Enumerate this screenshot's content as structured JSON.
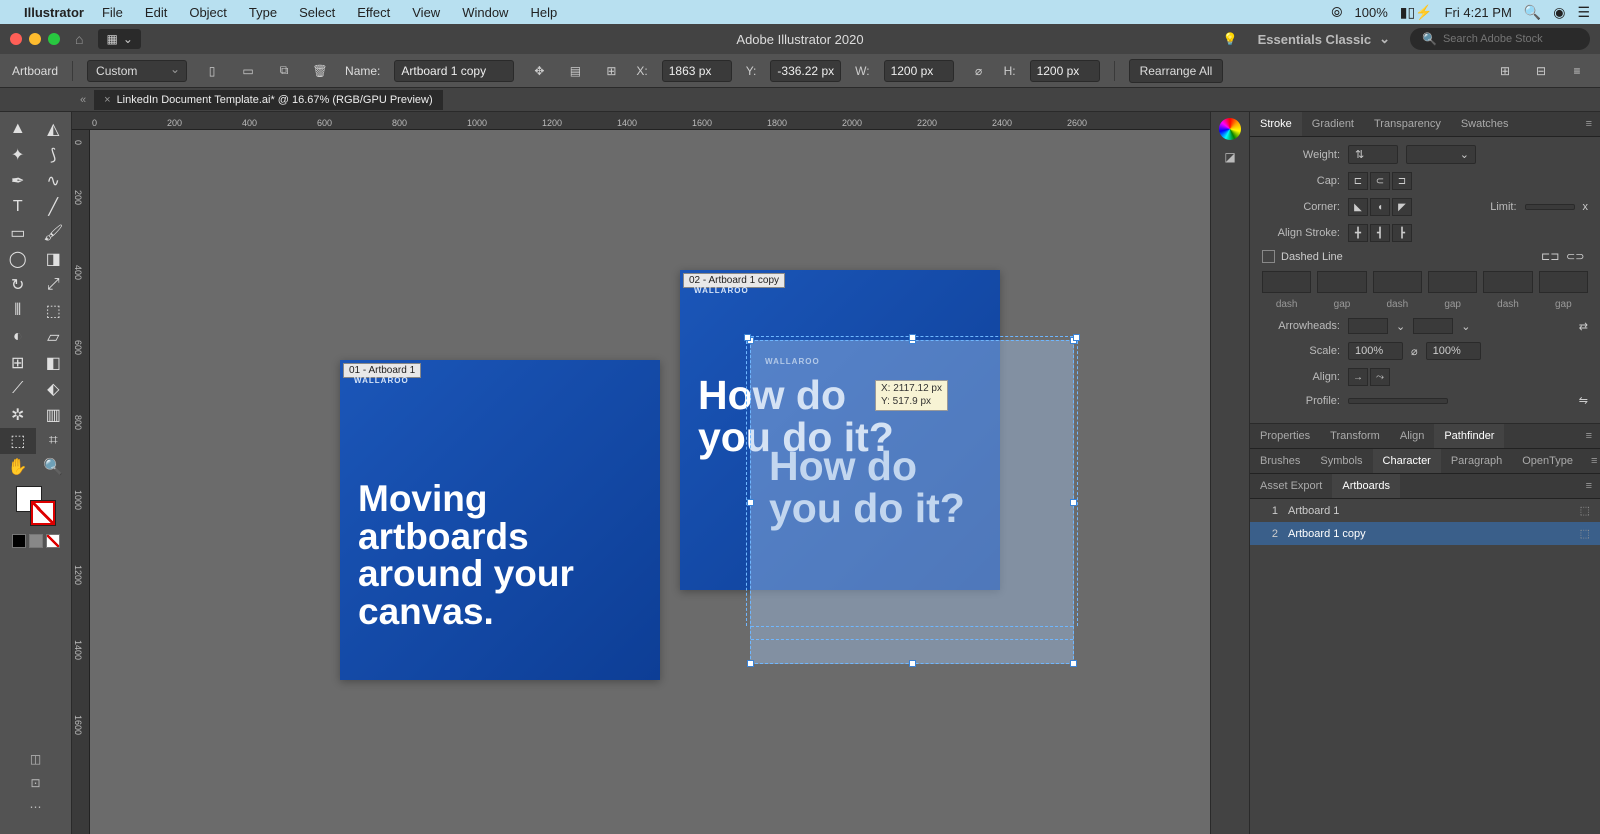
{
  "mac_menu": {
    "app": "Illustrator",
    "items": [
      "File",
      "Edit",
      "Object",
      "Type",
      "Select",
      "Effect",
      "View",
      "Window",
      "Help"
    ],
    "wifi": "wifi-icon",
    "battery_pct": "100%",
    "battery_icon": "battery-charging-icon",
    "clock": "Fri 4:21 PM"
  },
  "titlebar": {
    "app_title": "Adobe Illustrator 2020",
    "workspace": "Essentials Classic",
    "search_placeholder": "Search Adobe Stock"
  },
  "controlbar": {
    "tool_label": "Artboard",
    "preset": "Custom",
    "name_label": "Name:",
    "name_value": "Artboard 1 copy",
    "x_label": "X:",
    "x_value": "1863 px",
    "y_label": "Y:",
    "y_value": "-336.22 px",
    "w_label": "W:",
    "w_value": "1200 px",
    "h_label": "H:",
    "h_value": "1200 px",
    "rearrange": "Rearrange All"
  },
  "tab": {
    "title": "LinkedIn Document Template.ai* @ 16.67% (RGB/GPU Preview)"
  },
  "ruler_h": [
    "0",
    "200",
    "400",
    "600",
    "800",
    "1000",
    "1200",
    "1400",
    "1600",
    "1800",
    "2000",
    "2200",
    "2400",
    "2600"
  ],
  "ruler_v": [
    "0",
    "200",
    "400",
    "600",
    "800",
    "1000",
    "1200",
    "1400",
    "1600"
  ],
  "artboards": {
    "ab1": {
      "label": "01 - Artboard 1",
      "brand": "WALLAROO",
      "text": "Moving\nartboards\naround your\ncanvas."
    },
    "ab2": {
      "label": "02 - Artboard 1 copy",
      "brand": "WALLAROO",
      "text": "How do\nyou do it?"
    },
    "drag": {
      "brand": "WALLAROO",
      "text": "How do\nyou do it?",
      "tip_x": "X: 2117.12 px",
      "tip_y": "Y: 517.9 px"
    }
  },
  "panel_stroke": {
    "tabs": [
      "Stroke",
      "Gradient",
      "Transparency",
      "Swatches"
    ],
    "weight": "Weight:",
    "cap": "Cap:",
    "corner": "Corner:",
    "limit_label": "Limit:",
    "limit_suffix": "x",
    "align_stroke": "Align Stroke:",
    "dashed": "Dashed Line",
    "dash_labels": [
      "dash",
      "gap",
      "dash",
      "gap",
      "dash",
      "gap"
    ],
    "arrowheads": "Arrowheads:",
    "scale": "Scale:",
    "scale_val": "100%",
    "align": "Align:",
    "profile": "Profile:"
  },
  "panel_mid": {
    "tabs": [
      "Properties",
      "Transform",
      "Align",
      "Pathfinder"
    ],
    "tabs2": [
      "Brushes",
      "Symbols",
      "Character",
      "Paragraph",
      "OpenType"
    ]
  },
  "panel_artboards": {
    "tabs": [
      "Asset Export",
      "Artboards"
    ],
    "rows": [
      {
        "num": "1",
        "name": "Artboard 1"
      },
      {
        "num": "2",
        "name": "Artboard 1 copy"
      }
    ]
  }
}
